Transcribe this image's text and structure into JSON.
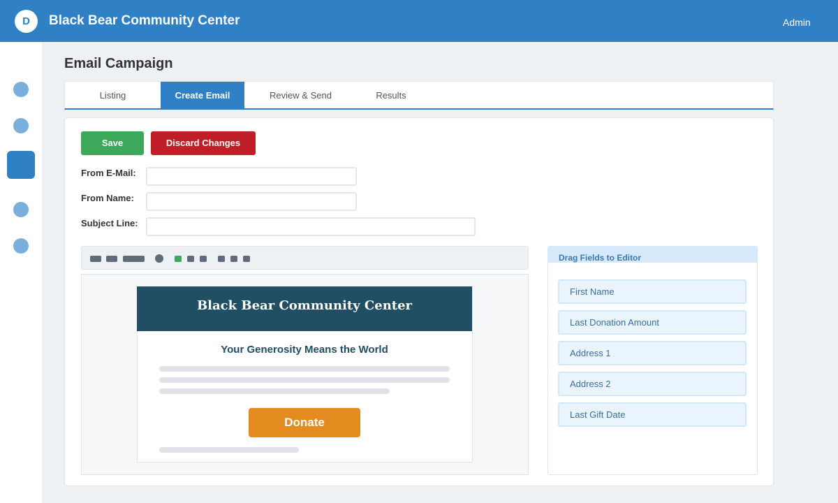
{
  "header": {
    "logo_letter": "D",
    "title": "Black Bear Community Center",
    "user": "Admin"
  },
  "sidebar": {
    "items": [
      "nav-item",
      "nav-item",
      "nav-item-active",
      "nav-item",
      "nav-item"
    ]
  },
  "page": {
    "title": "Email Campaign"
  },
  "tabs": [
    {
      "label": "Listing"
    },
    {
      "label": "Create Email",
      "active": true
    },
    {
      "label": "Review & Send"
    },
    {
      "label": "Results"
    }
  ],
  "actions": {
    "save_label": "Save",
    "discard_label": "Discard Changes"
  },
  "form": {
    "from_email": {
      "label": "From E-Mail:",
      "value": ""
    },
    "from_name": {
      "label": "From Name:",
      "value": ""
    },
    "subject": {
      "label": "Subject Line:",
      "value": ""
    }
  },
  "toolbar": {
    "accent_color": "#3ca85a"
  },
  "email_preview": {
    "header_title": "Black Bear Community Center",
    "heading": "Your Generosity Means the World",
    "button_label": "Donate",
    "header_color": "#204e62",
    "button_color": "#e28c1f"
  },
  "fields_panel": {
    "title": "Drag Fields to Editor",
    "fields": [
      "First Name",
      "Last Donation Amount",
      "Address 1",
      "Address 2",
      "Last Gift Date"
    ]
  },
  "colors": {
    "brand": "#3080c5",
    "save": "#3ca85a",
    "discard": "#c01f28"
  }
}
